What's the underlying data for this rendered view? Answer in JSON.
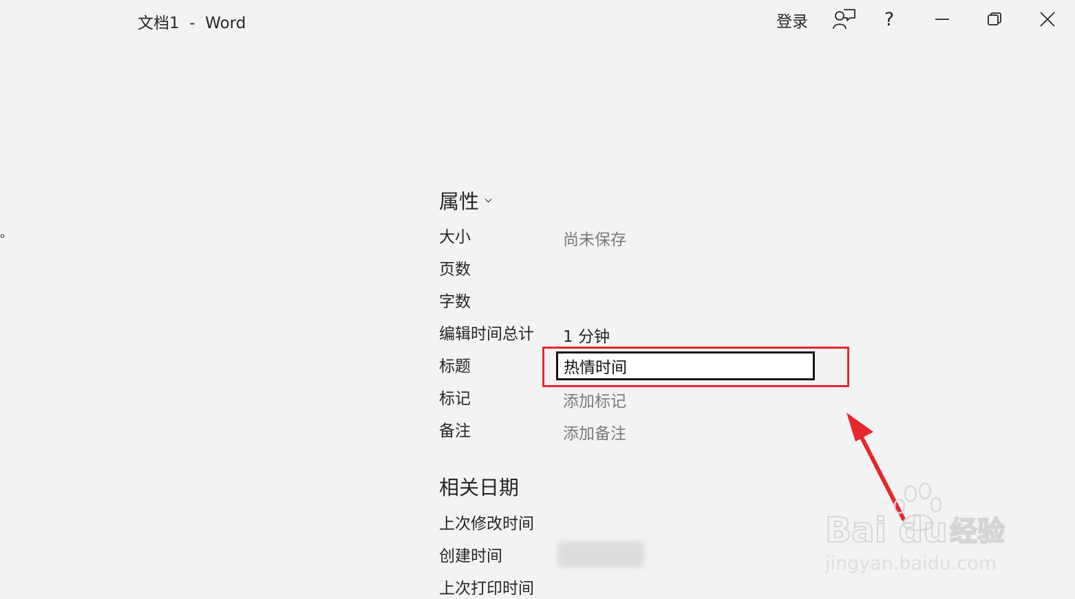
{
  "titlebar": {
    "app_title": "文档1  -  Word",
    "sign_in_label": "登录",
    "help_label": "?"
  },
  "left_edge_glyph": "。",
  "properties": {
    "header": "属性",
    "rows": [
      {
        "label": "大小",
        "value": "尚未保存"
      },
      {
        "label": "页数",
        "value": ""
      },
      {
        "label": "字数",
        "value": ""
      },
      {
        "label": "编辑时间总计",
        "value": "1 分钟"
      },
      {
        "label": "标题",
        "value": "热情时间"
      },
      {
        "label": "标记",
        "value": "添加标记"
      },
      {
        "label": "备注",
        "value": "添加备注"
      }
    ]
  },
  "related_dates": {
    "header": "相关日期",
    "rows": [
      {
        "label": "上次修改时间"
      },
      {
        "label": "创建时间"
      },
      {
        "label": "上次打印时间"
      }
    ]
  },
  "watermark": {
    "brand": "Bai du 经验",
    "url": "jingyan.baidu.com"
  },
  "colors": {
    "background": "#f3f3f3",
    "text": "#262626",
    "muted_text": "#7a7a7a",
    "annotation_red": "#e8262d"
  },
  "icons": [
    "feedback-icon",
    "minimize-icon",
    "restore-icon",
    "close-icon",
    "chevron-down-icon"
  ]
}
